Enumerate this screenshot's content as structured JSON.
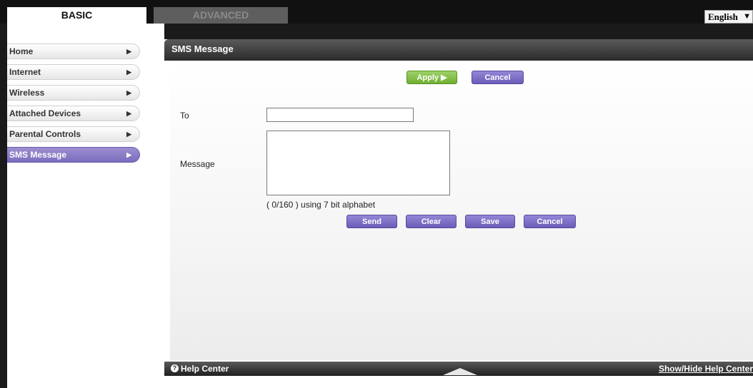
{
  "tabs": {
    "basic": "BASIC",
    "advanced": "ADVANCED"
  },
  "language": {
    "selected": "English"
  },
  "sidebar": {
    "items": [
      {
        "label": "Home"
      },
      {
        "label": "Internet"
      },
      {
        "label": "Wireless"
      },
      {
        "label": "Attached Devices"
      },
      {
        "label": "Parental Controls"
      },
      {
        "label": "SMS Message",
        "active": true
      }
    ]
  },
  "panel": {
    "title": "SMS Message",
    "apply_label": "Apply ▶",
    "cancel_label": "Cancel",
    "to_label": "To",
    "to_value": "",
    "message_label": "Message",
    "message_value": "",
    "char_count": "( 0/160 ) using 7 bit alphabet",
    "send_label": "Send",
    "clear_label": "Clear",
    "save_label": "Save",
    "cancel2_label": "Cancel"
  },
  "footer": {
    "help_label": "Help Center",
    "show_hide_label": "Show/Hide Help Center"
  },
  "icons": {
    "arrow": "triangle-right-icon",
    "help": "question-circle-icon",
    "footer_toggle": "triangle-up-icon"
  },
  "colors": {
    "accent_purple": "#7c6cbf",
    "apply_green": "#6fae31"
  }
}
